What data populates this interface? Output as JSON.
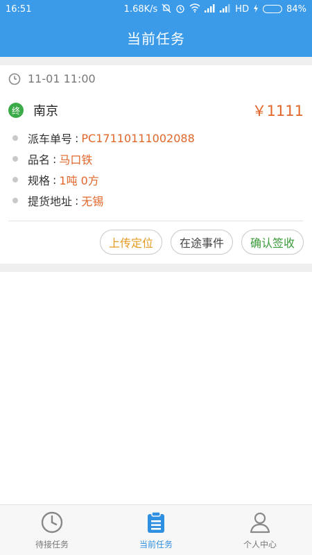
{
  "status_bar": {
    "time": "16:51",
    "network_speed": "1.68K/s",
    "network_type": "HD",
    "battery": "84%",
    "battery_level": 0.84
  },
  "header": {
    "title": "当前任务"
  },
  "task": {
    "time": "11-01 11:00",
    "end_badge": "终",
    "destination": "南京",
    "price": "￥1111",
    "details": [
      {
        "label": "派车单号",
        "separator": ":",
        "value": "PC17110111002088"
      },
      {
        "label": "品名",
        "separator": ":",
        "value": "马口铁"
      },
      {
        "label": "规格",
        "separator": ":",
        "value": "1吨 0方"
      },
      {
        "label": "提货地址",
        "separator": ":",
        "value": "无锡"
      }
    ],
    "actions": {
      "upload_location": "上传定位",
      "transit_event": "在途事件",
      "confirm_receipt": "确认签收"
    }
  },
  "tabbar": {
    "tabs": [
      {
        "label": "待接任务",
        "icon": "clock-icon",
        "active": false
      },
      {
        "label": "当前任务",
        "icon": "clipboard-icon",
        "active": true
      },
      {
        "label": "个人中心",
        "icon": "person-icon",
        "active": false
      }
    ]
  },
  "colors": {
    "primary": "#3b9be8",
    "price": "#e0662a",
    "end_badge": "#3bab4a",
    "active_tab": "#2f8fe0"
  }
}
